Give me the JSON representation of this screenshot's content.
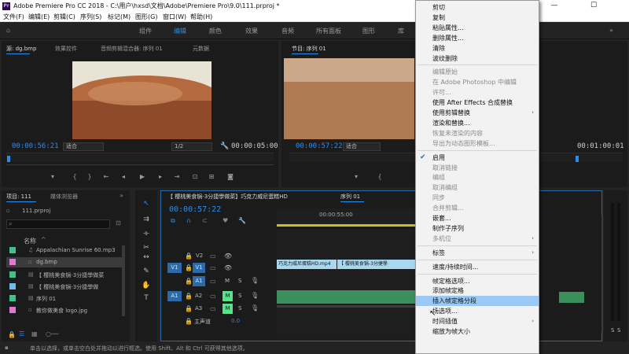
{
  "window": {
    "app_icon": "Pr",
    "title": "Adobe Premiere Pro CC 2018 - C:\\用户\\hxsd\\文档\\Adobe\\Premiere Pro\\9.0\\111.prproj *",
    "minimize": "—",
    "maximize": "☐"
  },
  "menubar": [
    "文件(F)",
    "编辑(E)",
    "剪辑(C)",
    "序列(S)",
    "标记(M)",
    "图形(G)",
    "窗口(W)",
    "帮助(H)"
  ],
  "workspaces": [
    "组件",
    "编辑",
    "颜色",
    "效果",
    "音频",
    "所有面板",
    "图形",
    "库"
  ],
  "workspace_more": "»",
  "source_monitor": {
    "tabs": [
      "源: dg.bmp",
      "效果控件",
      "音频剪辑混合器: 序列 01",
      "元数据"
    ],
    "timecode": "00:00:56:21",
    "fit": "适合",
    "resolution": "1/2",
    "duration": "00:00:05:00"
  },
  "program_monitor": {
    "tab": "节目: 序列 01",
    "timecode": "00:00:57:22",
    "fit": "适合",
    "duration": "00:01:00:01"
  },
  "project_panel": {
    "tabs": [
      "项目: 111",
      "媒体浏览器"
    ],
    "file": "111.prproj",
    "search_placeholder": "",
    "column_header": "名称",
    "items": [
      {
        "name": "Appalachian Sunrise 60.mp3",
        "color": "#3fc38a"
      },
      {
        "name": "dg.bmp",
        "color": "#e178d6"
      },
      {
        "name": "【 樱桃美食锅-3分捷學做菜",
        "color": "#3fc38a"
      },
      {
        "name": "【 樱桃美食锅-3分捷學做",
        "color": "#7ab6e8"
      },
      {
        "name": "序列 01",
        "color": "#3fc38a"
      },
      {
        "name": "教你做美食 logo.jpg",
        "color": "#e178d6"
      }
    ]
  },
  "timeline": {
    "tabs": [
      "【 樱桃美食锅-3分捷學做菜】巧克力威尼蛋糕HD",
      "序列 01"
    ],
    "timecode": "00:00:57:22",
    "ruler_label": "00:00:55:00",
    "tracks": [
      {
        "label": "V2"
      },
      {
        "label": "V1",
        "source": "V1"
      },
      {
        "label": "A1"
      },
      {
        "label": "A2",
        "source": "A1"
      },
      {
        "label": "A3"
      }
    ],
    "track_buttons": {
      "mute": "M",
      "solo": "S"
    },
    "master": {
      "label": "主声道",
      "value": "0.0"
    },
    "clips": [
      "巧克力威尼蛋糕HD.mp4",
      "【 樱桃美食锅-3分捷學"
    ]
  },
  "audio_meter": {
    "labels": [
      "S",
      "S"
    ]
  },
  "status_text": "单击以选择，或单击空白处并拖动以进行框选。使用 Shift、Alt 和 Ctrl 可获得其他选项。",
  "context_menu": {
    "items": [
      {
        "label": "剪切"
      },
      {
        "label": "复制"
      },
      {
        "label": "粘贴属性..."
      },
      {
        "label": "删除属性..."
      },
      {
        "label": "清除"
      },
      {
        "label": "波纹删除"
      },
      {
        "sep": true
      },
      {
        "label": "编辑原始",
        "disabled": true
      },
      {
        "label": "在 Adobe Photoshop 中编辑",
        "disabled": true
      },
      {
        "label": "许可...",
        "disabled": true
      },
      {
        "label": "使用 After Effects 合成替换"
      },
      {
        "label": "使用剪辑替换",
        "submenu": true
      },
      {
        "label": "渲染和替换..."
      },
      {
        "label": "恢复未渲染的内容",
        "disabled": true
      },
      {
        "label": "导出为动态图形模板...",
        "disabled": true
      },
      {
        "sep": true
      },
      {
        "label": "启用",
        "checked": true
      },
      {
        "label": "取消链接",
        "disabled": true
      },
      {
        "label": "编组",
        "disabled": true
      },
      {
        "label": "取消编组",
        "disabled": true
      },
      {
        "label": "同步",
        "disabled": true
      },
      {
        "label": "合并剪辑...",
        "disabled": true
      },
      {
        "label": "嵌套..."
      },
      {
        "label": "制作子序列"
      },
      {
        "label": "多机位",
        "disabled": true,
        "submenu": true
      },
      {
        "sep": true
      },
      {
        "label": "标签",
        "submenu": true
      },
      {
        "sep": true
      },
      {
        "label": "速度/持续时间..."
      },
      {
        "sep": true
      },
      {
        "label": "帧定格选项..."
      },
      {
        "label": "添加帧定格"
      },
      {
        "label": "插入帧定格分段",
        "highlighted": true
      },
      {
        "label": "场选项..."
      },
      {
        "label": "时间插值",
        "submenu": true
      },
      {
        "label": "缩放为帧大小"
      }
    ],
    "checkmark": "✔",
    "submenu_arrow": "›"
  },
  "colors": {
    "accent": "#2d8ceb",
    "video_clip": "#a8d8f0",
    "audio_clip": "#3a8f5a",
    "track_target": "#2d6aa8",
    "mute_green": "#5ce08c"
  }
}
